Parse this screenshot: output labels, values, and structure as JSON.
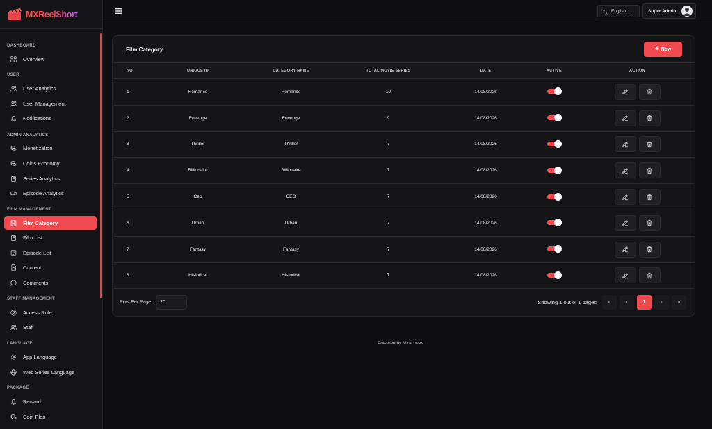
{
  "app": {
    "logo_text": "MXReelShort",
    "brand_color": "#ee4a4f"
  },
  "sidebar": {
    "sections": [
      {
        "label": "DASHBOARD",
        "items": [
          {
            "label": "Overview",
            "icon": "dashboard-icon"
          }
        ]
      },
      {
        "label": "USER",
        "items": [
          {
            "label": "User Analytics",
            "icon": "users-icon"
          },
          {
            "label": "User Management",
            "icon": "users-icon"
          },
          {
            "label": "Notifications",
            "icon": "bell-icon"
          }
        ]
      },
      {
        "label": "ADMIN ANALYTICS",
        "items": [
          {
            "label": "Monetization",
            "icon": "coins-icon"
          },
          {
            "label": "Coins Economy",
            "icon": "coins-icon"
          },
          {
            "label": "Series Analytics",
            "icon": "clipboard-icon"
          },
          {
            "label": "Episode Analytics",
            "icon": "video-icon"
          }
        ]
      },
      {
        "label": "FILM MANAGEMENT",
        "items": [
          {
            "label": "Film Category",
            "icon": "film-icon",
            "active": true
          },
          {
            "label": "Film List",
            "icon": "clipboard-icon"
          },
          {
            "label": "Episode List",
            "icon": "list-icon"
          },
          {
            "label": "Content",
            "icon": "document-icon"
          },
          {
            "label": "Comments",
            "icon": "comment-icon"
          }
        ]
      },
      {
        "label": "STAFF MANAGEMENT",
        "items": [
          {
            "label": "Access Role",
            "icon": "user-circle-icon"
          },
          {
            "label": "Staff",
            "icon": "users-icon"
          }
        ]
      },
      {
        "label": "LANGUAGE",
        "items": [
          {
            "label": "App Language",
            "icon": "gear-icon"
          },
          {
            "label": "Web Series Language",
            "icon": "globe-icon"
          }
        ]
      },
      {
        "label": "PACKAGE",
        "items": [
          {
            "label": "Reward",
            "icon": "bell-icon"
          },
          {
            "label": "Coin Plan",
            "icon": "coins-icon"
          }
        ]
      }
    ]
  },
  "topbar": {
    "language": "English",
    "user_name": "Super Admin"
  },
  "card": {
    "title": "Film Category",
    "new_button": "New",
    "columns": [
      "NO",
      "UNIQUE ID",
      "CATEGORY NAME",
      "TOTAL MOVIE SERIES",
      "DATE",
      "ACTIVE",
      "ACTION"
    ],
    "rows": [
      {
        "no": "1",
        "unique_id": "Romance",
        "category_name": "Romance",
        "total": "10",
        "date": "14/08/2026",
        "active": true
      },
      {
        "no": "2",
        "unique_id": "Revenge",
        "category_name": "Revenge",
        "total": "9",
        "date": "14/08/2026",
        "active": true
      },
      {
        "no": "3",
        "unique_id": "Thriller",
        "category_name": "Thriller",
        "total": "7",
        "date": "14/08/2026",
        "active": true
      },
      {
        "no": "4",
        "unique_id": "Billionaire",
        "category_name": "Billionaire",
        "total": "7",
        "date": "14/08/2026",
        "active": true
      },
      {
        "no": "5",
        "unique_id": "Ceo",
        "category_name": "CEO",
        "total": "7",
        "date": "14/08/2026",
        "active": true
      },
      {
        "no": "6",
        "unique_id": "Urban",
        "category_name": "Urban",
        "total": "7",
        "date": "14/08/2026",
        "active": true
      },
      {
        "no": "7",
        "unique_id": "Fantasy",
        "category_name": "Fantasy",
        "total": "7",
        "date": "14/08/2026",
        "active": true
      },
      {
        "no": "8",
        "unique_id": "Historical",
        "category_name": "Historical",
        "total": "7",
        "date": "14/08/2026",
        "active": true
      }
    ],
    "rows_per_page_label": "Row Per Page:",
    "rows_per_page_value": "20",
    "showing_text": "Showing 1 out of 1 pages",
    "pagination": {
      "first": "«",
      "prev": "‹",
      "current": "1",
      "next": "›",
      "last": "»"
    }
  },
  "footer": {
    "powered_by": "Powered by Miracuves"
  }
}
